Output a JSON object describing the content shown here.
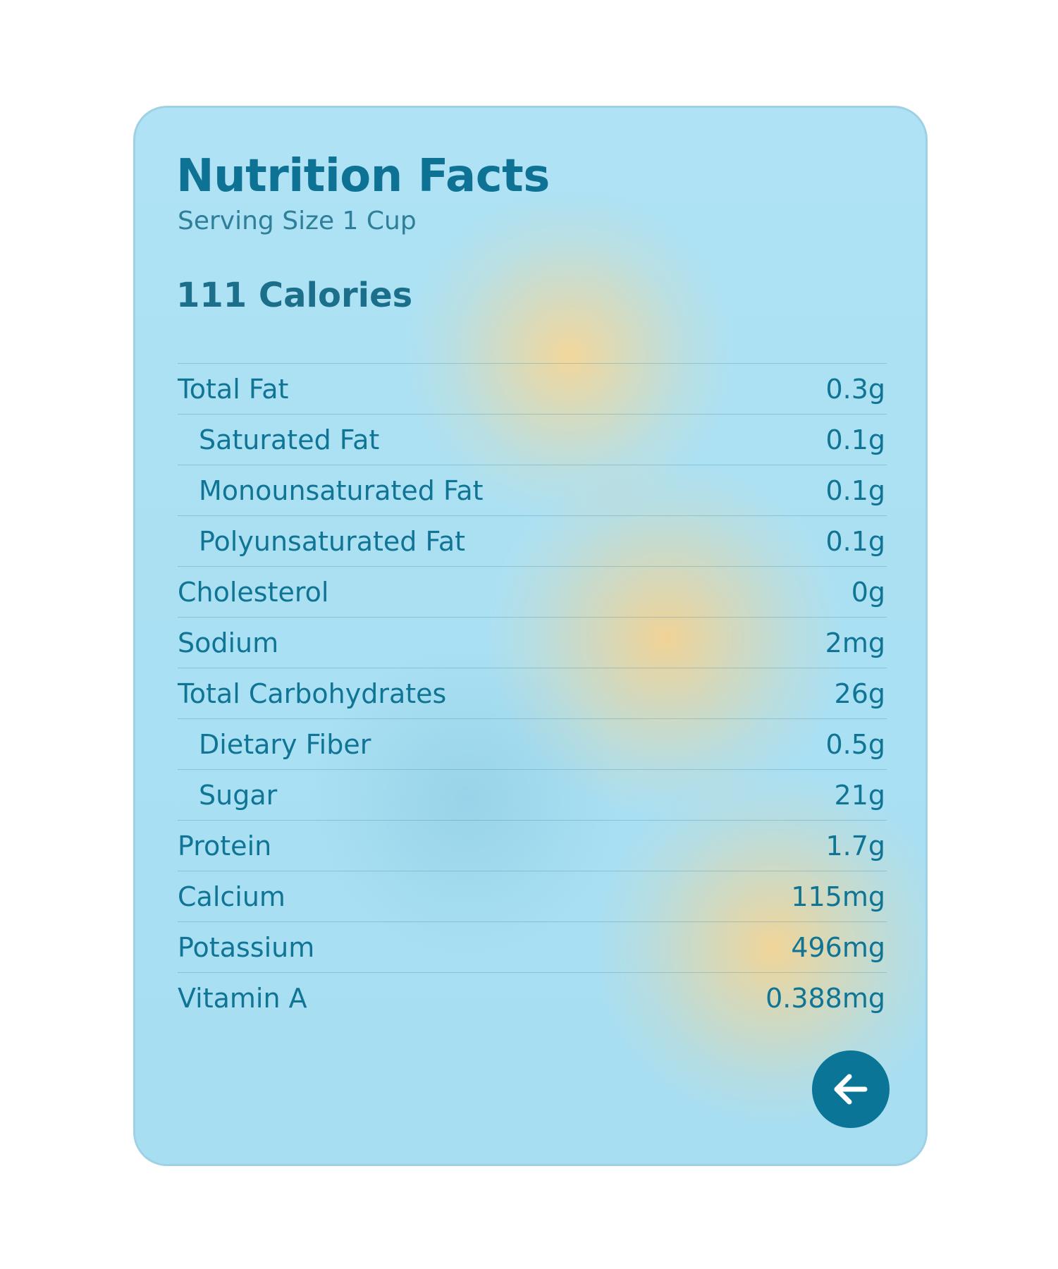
{
  "card": {
    "title": "Nutrition Facts",
    "serving_size": "Serving Size 1 Cup",
    "calories": "111 Calories"
  },
  "nutrients": [
    {
      "label": "Total Fat",
      "value": "0.3g",
      "sub": false
    },
    {
      "label": "Saturated Fat",
      "value": "0.1g",
      "sub": true
    },
    {
      "label": "Monounsaturated Fat",
      "value": "0.1g",
      "sub": true
    },
    {
      "label": "Polyunsaturated Fat",
      "value": "0.1g",
      "sub": true
    },
    {
      "label": "Cholesterol",
      "value": "0g",
      "sub": false
    },
    {
      "label": "Sodium",
      "value": "2mg",
      "sub": false
    },
    {
      "label": "Total Carbohydrates",
      "value": "26g",
      "sub": false
    },
    {
      "label": "Dietary Fiber",
      "value": "0.5g",
      "sub": true
    },
    {
      "label": "Sugar",
      "value": "21g",
      "sub": true
    },
    {
      "label": "Protein",
      "value": "1.7g",
      "sub": false
    },
    {
      "label": "Calcium",
      "value": "115mg",
      "sub": false
    },
    {
      "label": "Potassium",
      "value": "496mg",
      "sub": false
    },
    {
      "label": "Vitamin A",
      "value": "0.388mg",
      "sub": false
    }
  ],
  "back_button": {
    "icon": "arrow-left-icon"
  },
  "colors": {
    "accent": "#0a7597",
    "text": "#107594",
    "card_background": "#a9e0f3",
    "glow": "#f4d492"
  }
}
